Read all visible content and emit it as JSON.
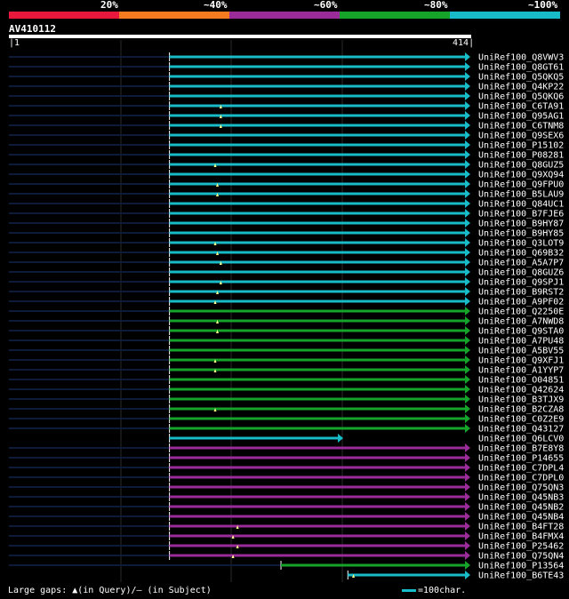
{
  "scale": {
    "labels": [
      "20%",
      "~40%",
      "~60%",
      "~80%",
      "~100%"
    ],
    "colors": [
      "#e8173c",
      "#f47b20",
      "#9a2c9a",
      "#15a32a",
      "#18bcc8"
    ]
  },
  "query": {
    "id": "AV410112",
    "start": "1",
    "end": "414",
    "length": 414
  },
  "hits": [
    {
      "id": "UniRef100_Q8VWV3",
      "color": "cyan",
      "start": 1,
      "end": 414,
      "qstart": 145
    },
    {
      "id": "UniRef100_Q8GT61",
      "color": "cyan",
      "start": 1,
      "end": 414,
      "qstart": 145
    },
    {
      "id": "UniRef100_Q5QKQ5",
      "color": "cyan",
      "start": 1,
      "end": 414,
      "qstart": 145
    },
    {
      "id": "UniRef100_Q4KP22",
      "color": "cyan",
      "start": 1,
      "end": 414,
      "qstart": 145
    },
    {
      "id": "UniRef100_Q5QKQ6",
      "color": "cyan",
      "start": 1,
      "end": 414,
      "qstart": 145
    },
    {
      "id": "UniRef100_C6TA91",
      "color": "cyan",
      "start": 1,
      "end": 414,
      "qstart": 145,
      "gap": 191
    },
    {
      "id": "UniRef100_Q95AG1",
      "color": "cyan",
      "start": 1,
      "end": 414,
      "qstart": 145,
      "gap": 191
    },
    {
      "id": "UniRef100_C6TNM8",
      "color": "cyan",
      "start": 1,
      "end": 414,
      "qstart": 145,
      "gap": 191
    },
    {
      "id": "UniRef100_Q9SEX6",
      "color": "cyan",
      "start": 1,
      "end": 414,
      "qstart": 145
    },
    {
      "id": "UniRef100_P15102",
      "color": "cyan",
      "start": 1,
      "end": 414,
      "qstart": 145
    },
    {
      "id": "UniRef100_P08281",
      "color": "cyan",
      "start": 1,
      "end": 414,
      "qstart": 145
    },
    {
      "id": "UniRef100_Q8GUZ5",
      "color": "cyan",
      "start": 1,
      "end": 414,
      "qstart": 145,
      "gap": 186
    },
    {
      "id": "UniRef100_Q9XQ94",
      "color": "cyan",
      "start": 1,
      "end": 414,
      "qstart": 145
    },
    {
      "id": "UniRef100_Q9FPU0",
      "color": "cyan",
      "start": 1,
      "end": 414,
      "qstart": 145,
      "gap": 188
    },
    {
      "id": "UniRef100_B5LAU9",
      "color": "cyan",
      "start": 1,
      "end": 414,
      "qstart": 145,
      "gap": 188
    },
    {
      "id": "UniRef100_Q84UC1",
      "color": "cyan",
      "start": 1,
      "end": 414,
      "qstart": 145
    },
    {
      "id": "UniRef100_B7FJE6",
      "color": "cyan",
      "start": 1,
      "end": 414,
      "qstart": 145
    },
    {
      "id": "UniRef100_B9HY87",
      "color": "cyan",
      "start": 1,
      "end": 414,
      "qstart": 145
    },
    {
      "id": "UniRef100_B9HY85",
      "color": "cyan",
      "start": 1,
      "end": 414,
      "qstart": 145
    },
    {
      "id": "UniRef100_Q3LOT9",
      "color": "cyan",
      "start": 1,
      "end": 414,
      "qstart": 145,
      "gap": 186
    },
    {
      "id": "UniRef100_Q69B32",
      "color": "cyan",
      "start": 1,
      "end": 414,
      "qstart": 145,
      "gap": 188
    },
    {
      "id": "UniRef100_A5A7P7",
      "color": "cyan",
      "start": 1,
      "end": 414,
      "qstart": 145,
      "gap": 191
    },
    {
      "id": "UniRef100_Q8GUZ6",
      "color": "cyan",
      "start": 1,
      "end": 414,
      "qstart": 145
    },
    {
      "id": "UniRef100_Q9SPJ1",
      "color": "cyan",
      "start": 1,
      "end": 414,
      "qstart": 145,
      "gap": 191
    },
    {
      "id": "UniRef100_B9RST2",
      "color": "cyan",
      "start": 1,
      "end": 414,
      "qstart": 145,
      "gap": 188
    },
    {
      "id": "UniRef100_A9PF02",
      "color": "cyan",
      "start": 1,
      "end": 414,
      "qstart": 145,
      "gap": 186
    },
    {
      "id": "UniRef100_Q2250E",
      "color": "green",
      "start": 1,
      "end": 414,
      "qstart": 145
    },
    {
      "id": "UniRef100_A7NWD8",
      "color": "green",
      "start": 1,
      "end": 414,
      "qstart": 145,
      "gap": 188
    },
    {
      "id": "UniRef100_Q9STA0",
      "color": "green",
      "start": 1,
      "end": 414,
      "qstart": 145,
      "gap": 188
    },
    {
      "id": "UniRef100_A7PU48",
      "color": "green",
      "start": 1,
      "end": 414,
      "qstart": 145
    },
    {
      "id": "UniRef100_A5BV55",
      "color": "green",
      "start": 1,
      "end": 414,
      "qstart": 145
    },
    {
      "id": "UniRef100_Q9XFJ1",
      "color": "green",
      "start": 1,
      "end": 414,
      "qstart": 145,
      "gap": 186
    },
    {
      "id": "UniRef100_A1YYP7",
      "color": "green",
      "start": 1,
      "end": 414,
      "qstart": 145,
      "gap": 186
    },
    {
      "id": "UniRef100_O04851",
      "color": "green",
      "start": 1,
      "end": 414,
      "qstart": 145
    },
    {
      "id": "UniRef100_Q42624",
      "color": "green",
      "start": 1,
      "end": 414,
      "qstart": 145
    },
    {
      "id": "UniRef100_B3TJX9",
      "color": "green",
      "start": 1,
      "end": 414,
      "qstart": 145
    },
    {
      "id": "UniRef100_B2CZA8",
      "color": "green",
      "start": 1,
      "end": 414,
      "qstart": 145,
      "gap": 186
    },
    {
      "id": "UniRef100_C0Z2E9",
      "color": "green",
      "start": 1,
      "end": 414,
      "qstart": 145
    },
    {
      "id": "UniRef100_Q43127",
      "color": "green",
      "start": 1,
      "end": 414,
      "qstart": 145
    },
    {
      "id": "UniRef100_Q6LCV0",
      "color": "cyan",
      "start": 145,
      "end": 300,
      "qstart": 145
    },
    {
      "id": "UniRef100_B7E8Y8",
      "color": "purple",
      "start": 1,
      "end": 414,
      "qstart": 145
    },
    {
      "id": "UniRef100_P14655",
      "color": "purple",
      "start": 1,
      "end": 414,
      "qstart": 145
    },
    {
      "id": "UniRef100_C7DPL4",
      "color": "purple",
      "start": 1,
      "end": 414,
      "qstart": 145
    },
    {
      "id": "UniRef100_C7DPL0",
      "color": "purple",
      "start": 1,
      "end": 414,
      "qstart": 145
    },
    {
      "id": "UniRef100_Q75QN3",
      "color": "purple",
      "start": 1,
      "end": 414,
      "qstart": 145
    },
    {
      "id": "UniRef100_Q45NB3",
      "color": "purple",
      "start": 1,
      "end": 414,
      "qstart": 145
    },
    {
      "id": "UniRef100_Q45NB2",
      "color": "purple",
      "start": 1,
      "end": 414,
      "qstart": 145
    },
    {
      "id": "UniRef100_Q45NB4",
      "color": "purple",
      "start": 1,
      "end": 414,
      "qstart": 145
    },
    {
      "id": "UniRef100_B4FT28",
      "color": "purple",
      "start": 1,
      "end": 414,
      "qstart": 145,
      "gap": 206
    },
    {
      "id": "UniRef100_B4FMX4",
      "color": "purple",
      "start": 1,
      "end": 414,
      "qstart": 145,
      "gap": 202
    },
    {
      "id": "UniRef100_P25462",
      "color": "purple",
      "start": 1,
      "end": 414,
      "qstart": 145,
      "gap": 206
    },
    {
      "id": "UniRef100_Q75QN4",
      "color": "purple",
      "start": 1,
      "end": 414,
      "qstart": 145,
      "gap": 202
    },
    {
      "id": "UniRef100_P13564",
      "color": "green",
      "start": 1,
      "end": 414,
      "qstart": 245
    },
    {
      "id": "UniRef100_B6TE43",
      "color": "cyan",
      "start": 305,
      "end": 414,
      "qstart": 305,
      "gap": 310
    }
  ],
  "legend": {
    "text": "Large gaps: ▲(in Query)/— (in Subject)",
    "scale_text": "=100char."
  }
}
